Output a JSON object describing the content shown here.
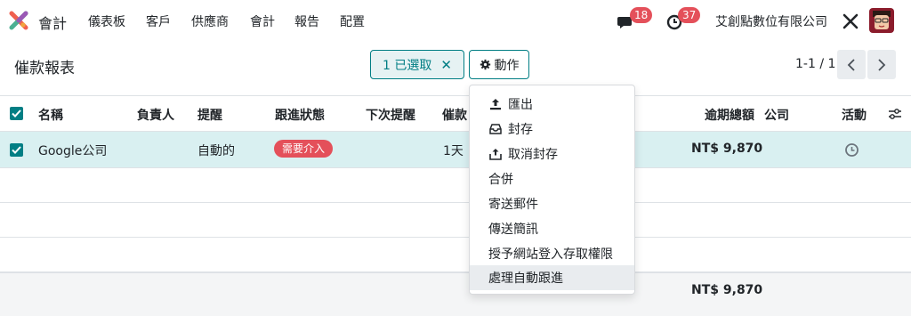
{
  "navbar": {
    "app_name": "會計",
    "menu": [
      "儀表板",
      "客戶",
      "供應商",
      "會計",
      "報告",
      "配置"
    ],
    "messages_count": "18",
    "activities_count": "37",
    "company": "艾創點數位有限公司"
  },
  "control_panel": {
    "title": "催款報表",
    "selected_label": "1 已選取",
    "action_label": "動作",
    "pager": "1-1 / 1"
  },
  "table": {
    "headers": {
      "name": "名稱",
      "owner": "負責人",
      "reminder": "提醒",
      "followup_status": "跟進狀態",
      "next_reminder": "下次提醒",
      "overdue_partial": "催款",
      "total_overdue": "逾期總額",
      "company": "公司",
      "activity": "活動"
    },
    "rows": [
      {
        "name": "Google公司",
        "reminder": "自動的",
        "status": "需要介入",
        "followup_days": "1天",
        "total_overdue": "NT$ 9,870"
      }
    ],
    "footer_total": "NT$ 9,870"
  },
  "dropdown": {
    "items": [
      {
        "label": "匯出",
        "icon": "upload-icon"
      },
      {
        "label": "封存",
        "icon": "archive-icon"
      },
      {
        "label": "取消封存",
        "icon": "unarchive-icon"
      },
      {
        "label": "合併",
        "icon": ""
      },
      {
        "label": "寄送郵件",
        "icon": ""
      },
      {
        "label": "傳送簡訊",
        "icon": ""
      },
      {
        "label": "授予網站登入存取權限",
        "icon": ""
      },
      {
        "label": "處理自動跟進",
        "icon": ""
      }
    ],
    "highlighted_index": 7
  },
  "colors": {
    "primary": "#017e84",
    "selected_row": "#d9f0f1",
    "danger": "#e4505a",
    "footer": "#f4f5f6"
  }
}
